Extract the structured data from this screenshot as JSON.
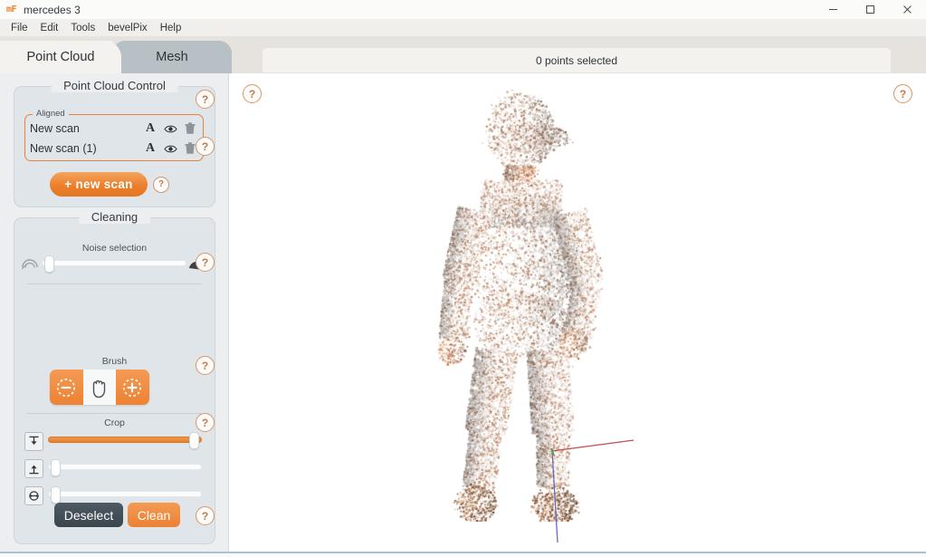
{
  "window": {
    "logo_text": "mF",
    "title": "mercedes 3",
    "controls": [
      {
        "name": "minimize",
        "glyph": "–"
      },
      {
        "name": "maximize",
        "glyph": "☐"
      },
      {
        "name": "close",
        "glyph": "✕"
      }
    ]
  },
  "menubar": {
    "items": [
      "File",
      "Edit",
      "Tools",
      "bevelPix",
      "Help"
    ]
  },
  "tabs": [
    {
      "label": "Point Cloud",
      "active": true
    },
    {
      "label": "Mesh",
      "active": false
    }
  ],
  "status": {
    "text": "0 points selected"
  },
  "point_cloud_control": {
    "title": "Point Cloud Control",
    "group_label": "Aligned",
    "scans": [
      {
        "name": "New scan",
        "align_label": "A",
        "visible_icon": "eye-icon",
        "delete_icon": "trash-icon"
      },
      {
        "name": "New scan (1)",
        "align_label": "A",
        "visible_icon": "eye-icon",
        "delete_icon": "trash-icon"
      }
    ],
    "new_scan_button": "+ new scan",
    "help_label": "?"
  },
  "cleaning": {
    "title": "Cleaning",
    "noise_selection": {
      "label": "Noise selection",
      "value_percent": 2,
      "icon_left": "noise-low-icon",
      "icon_right": "noise-high-icon"
    },
    "brush": {
      "label": "Brush",
      "buttons": [
        {
          "name": "brush-subtract",
          "icon": "minus-circle-dashed-icon",
          "state": "active"
        },
        {
          "name": "brush-pan",
          "icon": "hand-icon",
          "state": "inactive"
        },
        {
          "name": "brush-add",
          "icon": "plus-circle-dashed-icon",
          "state": "active"
        }
      ]
    },
    "crop": {
      "label": "Crop",
      "sliders": [
        {
          "name": "crop-top",
          "icon": "arrow-down-to-line-icon",
          "value_percent": 97
        },
        {
          "name": "crop-bottom",
          "icon": "arrow-up-from-line-icon",
          "value_percent": 2
        },
        {
          "name": "crop-radial",
          "icon": "circle-horizontal-arrows-icon",
          "value_percent": 2
        }
      ]
    },
    "deselect_button": "Deselect",
    "clean_button": "Clean",
    "help_label": "?"
  },
  "viewport": {
    "help_left_label": "?",
    "help_right_label": "?",
    "object_description": "3D scanned human figure point cloud",
    "axes": [
      {
        "name": "x-axis",
        "color": "#c0504d"
      },
      {
        "name": "z-axis",
        "color": "#6a6ab5"
      },
      {
        "name": "y-axis",
        "color": "#4f9e4f"
      }
    ]
  },
  "colors": {
    "accent_orange": "#e8823a",
    "panel_bg": "#dfe5e8",
    "sidebar_bg": "#eceef0",
    "tab_inactive": "#b7c0c4",
    "dark_button": "#3f4b52"
  }
}
